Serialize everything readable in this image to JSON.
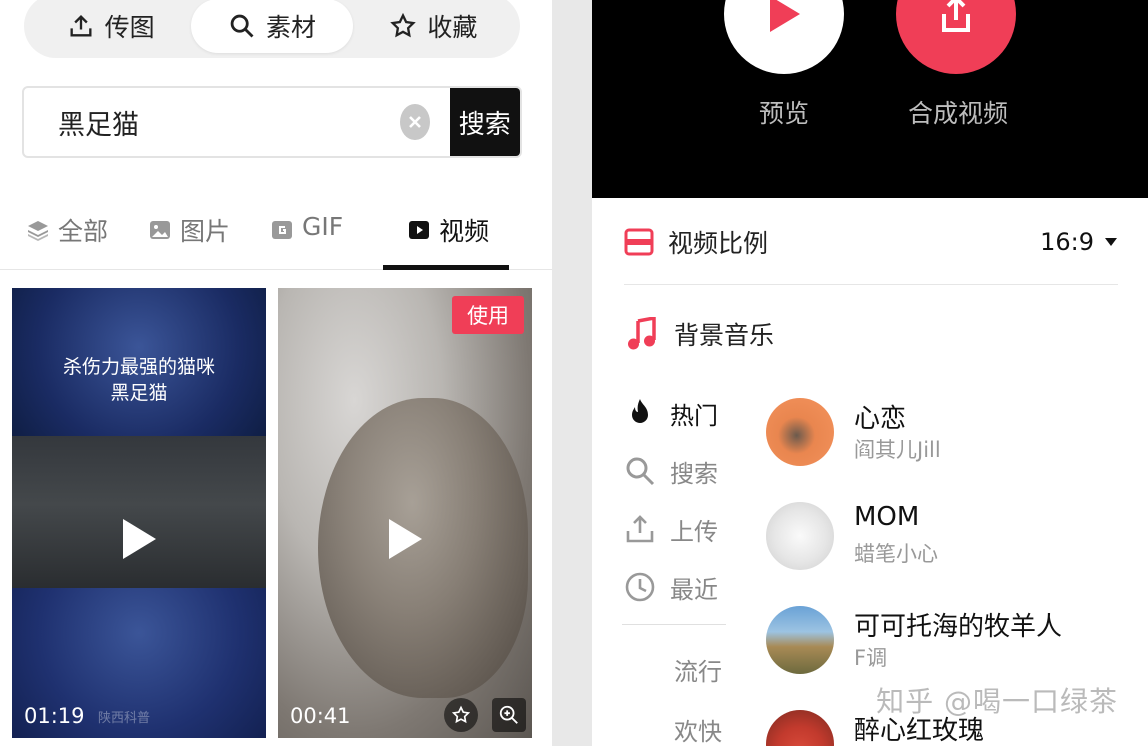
{
  "left_panel": {
    "segment_tabs": [
      {
        "label": "传图",
        "icon": "upload-icon"
      },
      {
        "label": "素材",
        "icon": "search-icon"
      },
      {
        "label": "收藏",
        "icon": "star-icon"
      }
    ],
    "search": {
      "value": "黑足猫",
      "button_label": "搜索"
    },
    "filter_tabs": [
      {
        "label": "全部",
        "icon": "layers-icon"
      },
      {
        "label": "图片",
        "icon": "image-icon"
      },
      {
        "label": "GIF",
        "icon": "gif-icon"
      },
      {
        "label": "视频",
        "icon": "video-icon"
      }
    ],
    "videos": [
      {
        "caption_line1": "杀伤力最强的猫咪",
        "caption_line2": "黑足猫",
        "duration": "01:19",
        "watermark": "陕西科普"
      },
      {
        "duration": "00:41",
        "use_badge": "使用"
      }
    ]
  },
  "right_panel": {
    "actions": [
      {
        "label": "预览",
        "icon": "play-icon"
      },
      {
        "label": "合成视频",
        "icon": "export-icon"
      }
    ],
    "ratio": {
      "label": "视频比例",
      "value": "16:9"
    },
    "music": {
      "title": "背景音乐",
      "categories": [
        {
          "label": "热门",
          "icon": "fire-icon"
        },
        {
          "label": "搜索",
          "icon": "search-icon"
        },
        {
          "label": "上传",
          "icon": "upload-icon"
        },
        {
          "label": "最近",
          "icon": "clock-icon"
        }
      ],
      "genres": [
        "流行",
        "欢快"
      ],
      "songs": [
        {
          "title": "心恋",
          "artist": "阎其儿Jill"
        },
        {
          "title": "MOM",
          "artist": "蜡笔小心"
        },
        {
          "title": "可可托海的牧羊人",
          "artist": "F调"
        },
        {
          "title": "醉心红玫瑰",
          "artist": ""
        }
      ]
    }
  },
  "watermark": "知乎 @喝一口绿茶",
  "colors": {
    "accent": "#f03e57",
    "dark": "#111111"
  }
}
